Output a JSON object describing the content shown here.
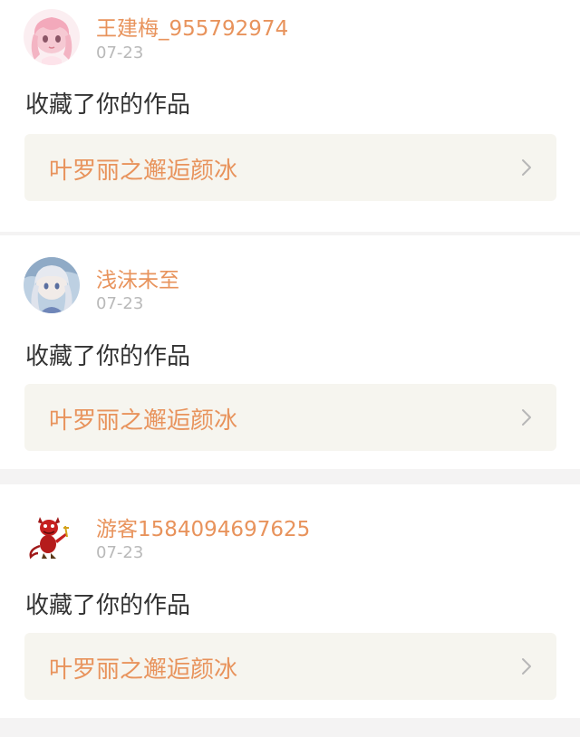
{
  "notifications": [
    {
      "avatar_icon": "anime-girl-pink-avatar-icon",
      "username": "王建梅_955792974",
      "date": "07-23",
      "action": "收藏了你的作品",
      "work_title": "叶罗丽之邂逅颜冰"
    },
    {
      "avatar_icon": "anime-girl-silver-hair-avatar-icon",
      "username": "浅沫未至",
      "date": "07-23",
      "action": "收藏了你的作品",
      "work_title": "叶罗丽之邂逅颜冰"
    },
    {
      "avatar_icon": "red-devil-mascot-avatar-icon",
      "username": "游客1584094697625",
      "date": "07-23",
      "action": "收藏了你的作品",
      "work_title": "叶罗丽之邂逅颜冰"
    }
  ],
  "colors": {
    "accent": "#e8935c",
    "date_gray": "#b9b9b9",
    "text": "#333333",
    "card_bg": "#ffffff",
    "link_bg": "#f6f5ef",
    "separator_bg": "#f4f3f3"
  },
  "chevron_icon": "chevron-right-icon"
}
